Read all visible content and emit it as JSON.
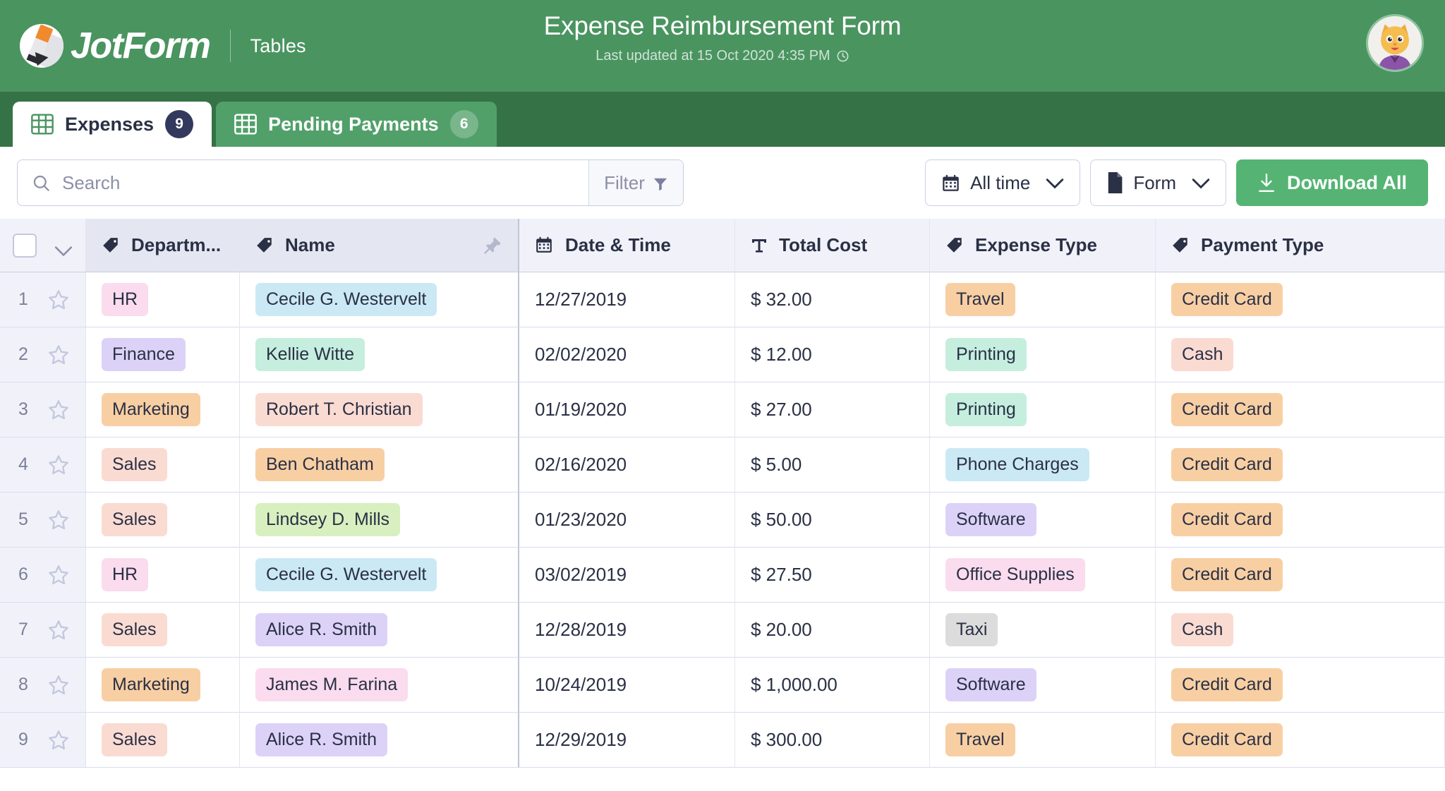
{
  "header": {
    "brand_name": "JotForm",
    "brand_section": "Tables",
    "title": "Expense Reimbursement Form",
    "subtitle": "Last updated at 15 Oct 2020 4:35 PM",
    "clock_icon": "clock-icon",
    "avatar_icon": "cat-avatar",
    "bg_color": "#4a9460"
  },
  "tabs": [
    {
      "label": "Expenses",
      "badge": "9",
      "active": true,
      "icon": "grid-icon"
    },
    {
      "label": "Pending Payments",
      "badge": "6",
      "active": false,
      "icon": "grid-icon"
    }
  ],
  "toolbar": {
    "search_placeholder": "Search",
    "search_value": "",
    "search_icon": "search-icon",
    "filter_label": "Filter",
    "filter_icon": "funnel-icon",
    "date_filter_label": "All time",
    "date_filter_icon": "calendar-icon",
    "source_filter_label": "Form",
    "source_filter_icon": "document-icon",
    "download_label": "Download All",
    "download_icon": "download-icon",
    "download_color": "#55b473"
  },
  "table": {
    "columns": [
      {
        "label": "",
        "icon": "checkbox-icon",
        "key": "select"
      },
      {
        "label": "Departm...",
        "icon": "tag-icon",
        "key": "department"
      },
      {
        "label": "Name",
        "icon": "tag-icon",
        "key": "name",
        "pinned": true
      },
      {
        "label": "Date & Time",
        "icon": "calendar-icon",
        "key": "date"
      },
      {
        "label": "Total Cost",
        "icon": "text-icon",
        "key": "cost"
      },
      {
        "label": "Expense Type",
        "icon": "tag-icon",
        "key": "expense_type"
      },
      {
        "label": "Payment Type",
        "icon": "tag-icon",
        "key": "payment_type"
      }
    ],
    "rows": [
      {
        "index": "1",
        "department": {
          "text": "HR",
          "bg": "#fadcee"
        },
        "name": {
          "text": "Cecile G. Westervelt",
          "bg": "#cbe9f5"
        },
        "date": "12/27/2019",
        "cost": "$ 32.00",
        "expense_type": {
          "text": "Travel",
          "bg": "#f8cfa3"
        },
        "payment_type": {
          "text": "Credit Card",
          "bg": "#f8cfa3"
        }
      },
      {
        "index": "2",
        "department": {
          "text": "Finance",
          "bg": "#dcd2f7"
        },
        "name": {
          "text": "Kellie Witte",
          "bg": "#c5eede"
        },
        "date": "02/02/2020",
        "cost": "$ 12.00",
        "expense_type": {
          "text": "Printing",
          "bg": "#c5eede"
        },
        "payment_type": {
          "text": "Cash",
          "bg": "#fadbd2"
        }
      },
      {
        "index": "3",
        "department": {
          "text": "Marketing",
          "bg": "#f8cfa3"
        },
        "name": {
          "text": "Robert T. Christian",
          "bg": "#fadbd2"
        },
        "date": "01/19/2020",
        "cost": "$ 27.00",
        "expense_type": {
          "text": "Printing",
          "bg": "#c5eede"
        },
        "payment_type": {
          "text": "Credit Card",
          "bg": "#f8cfa3"
        }
      },
      {
        "index": "4",
        "department": {
          "text": "Sales",
          "bg": "#fadbd2"
        },
        "name": {
          "text": "Ben Chatham",
          "bg": "#f8cfa3"
        },
        "date": "02/16/2020",
        "cost": "$ 5.00",
        "expense_type": {
          "text": "Phone Charges",
          "bg": "#cbe9f5"
        },
        "payment_type": {
          "text": "Credit Card",
          "bg": "#f8cfa3"
        }
      },
      {
        "index": "5",
        "department": {
          "text": "Sales",
          "bg": "#fadbd2"
        },
        "name": {
          "text": "Lindsey D. Mills",
          "bg": "#d8f0bf"
        },
        "date": "01/23/2020",
        "cost": "$ 50.00",
        "expense_type": {
          "text": "Software",
          "bg": "#dcd2f7"
        },
        "payment_type": {
          "text": "Credit Card",
          "bg": "#f8cfa3"
        }
      },
      {
        "index": "6",
        "department": {
          "text": "HR",
          "bg": "#fadcee"
        },
        "name": {
          "text": "Cecile G. Westervelt",
          "bg": "#cbe9f5"
        },
        "date": "03/02/2019",
        "cost": "$ 27.50",
        "expense_type": {
          "text": "Office Supplies",
          "bg": "#fadcee"
        },
        "payment_type": {
          "text": "Credit Card",
          "bg": "#f8cfa3"
        }
      },
      {
        "index": "7",
        "department": {
          "text": "Sales",
          "bg": "#fadbd2"
        },
        "name": {
          "text": "Alice R. Smith",
          "bg": "#dcd2f7"
        },
        "date": "12/28/2019",
        "cost": "$ 20.00",
        "expense_type": {
          "text": "Taxi",
          "bg": "#dcdcdc"
        },
        "payment_type": {
          "text": "Cash",
          "bg": "#fadbd2"
        }
      },
      {
        "index": "8",
        "department": {
          "text": "Marketing",
          "bg": "#f8cfa3"
        },
        "name": {
          "text": "James M. Farina",
          "bg": "#fadcee"
        },
        "date": "10/24/2019",
        "cost": "$ 1,000.00",
        "expense_type": {
          "text": "Software",
          "bg": "#dcd2f7"
        },
        "payment_type": {
          "text": "Credit Card",
          "bg": "#f8cfa3"
        }
      },
      {
        "index": "9",
        "department": {
          "text": "Sales",
          "bg": "#fadbd2"
        },
        "name": {
          "text": "Alice R. Smith",
          "bg": "#dcd2f7"
        },
        "date": "12/29/2019",
        "cost": "$ 300.00",
        "expense_type": {
          "text": "Travel",
          "bg": "#f8cfa3"
        },
        "payment_type": {
          "text": "Credit Card",
          "bg": "#f8cfa3"
        }
      }
    ]
  }
}
